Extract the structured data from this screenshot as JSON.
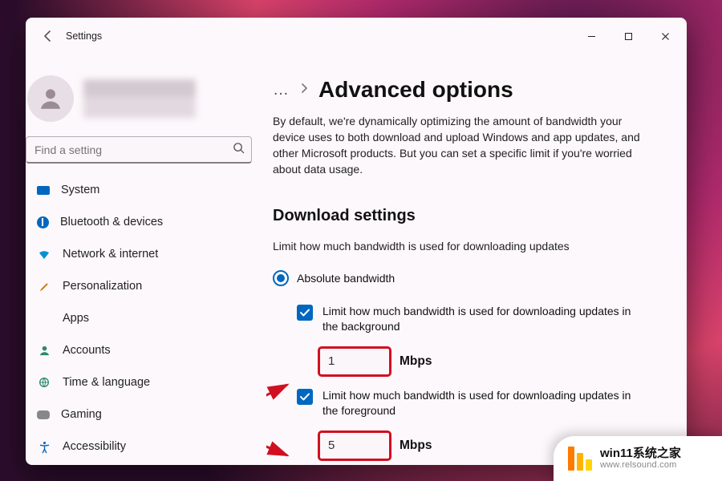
{
  "app": {
    "title": "Settings"
  },
  "search": {
    "placeholder": "Find a setting"
  },
  "sidebar": {
    "items": [
      {
        "label": "System"
      },
      {
        "label": "Bluetooth & devices"
      },
      {
        "label": "Network & internet"
      },
      {
        "label": "Personalization"
      },
      {
        "label": "Apps"
      },
      {
        "label": "Accounts"
      },
      {
        "label": "Time & language"
      },
      {
        "label": "Gaming"
      },
      {
        "label": "Accessibility"
      }
    ]
  },
  "breadcrumb": {
    "overflow": "…",
    "page_title": "Advanced options"
  },
  "description": "By default, we're dynamically optimizing the amount of bandwidth your device uses to both download and upload Windows and app updates, and other Microsoft products. But you can set a specific limit if you're worried about data usage.",
  "download": {
    "section_title": "Download settings",
    "subhead": "Limit how much bandwidth is used for downloading updates",
    "radio_label": "Absolute bandwidth",
    "bg": {
      "label": "Limit how much bandwidth is used for downloading updates in the background",
      "value": "1",
      "unit": "Mbps"
    },
    "fg": {
      "label": "Limit how much bandwidth is used for downloading updates in the foreground",
      "value": "5",
      "unit": "Mbps"
    }
  },
  "colors": {
    "accent": "#0067c0",
    "highlight_border": "#d01020"
  },
  "badge": {
    "title": "win11系统之家",
    "url": "www.relsound.com"
  }
}
